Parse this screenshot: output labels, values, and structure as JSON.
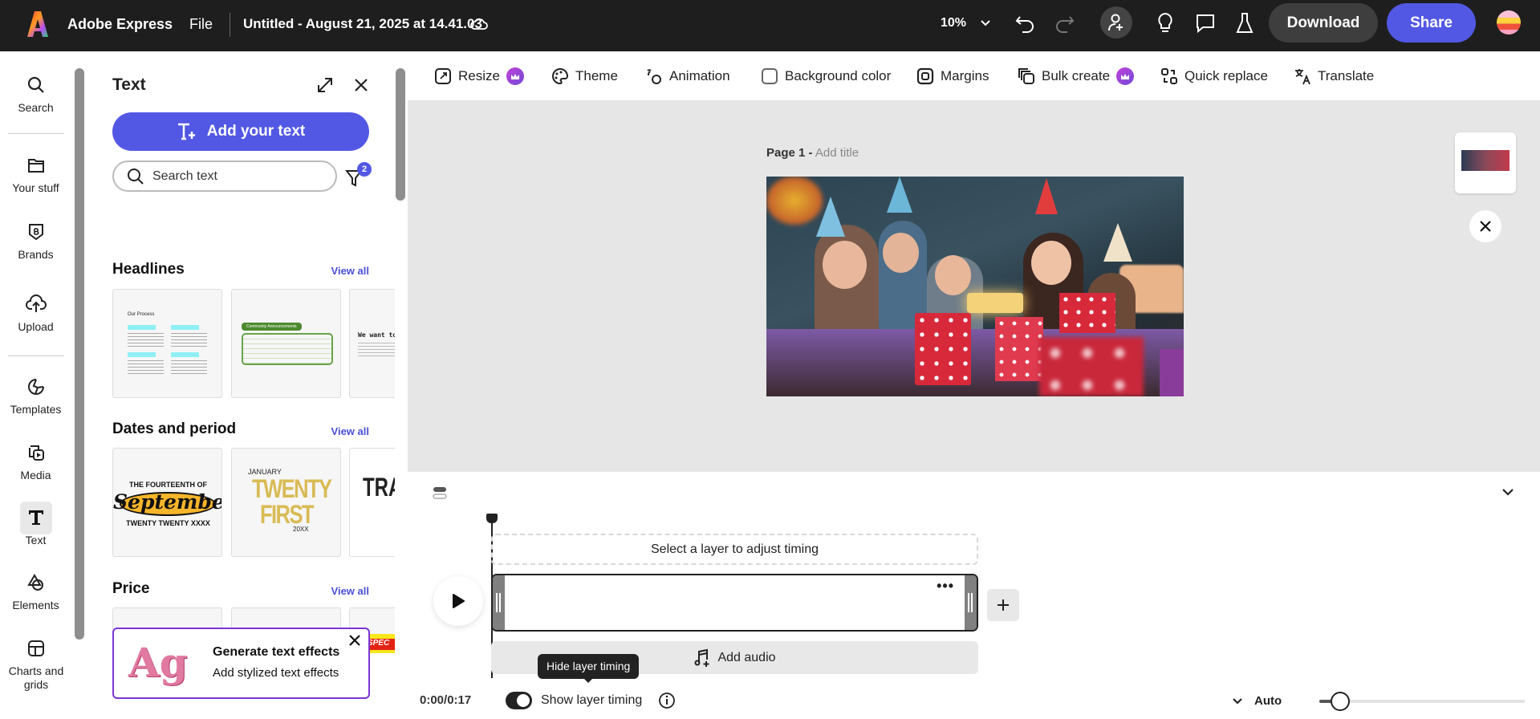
{
  "topbar": {
    "app_name": "Adobe Express",
    "file_menu": "File",
    "doc_title": "Untitled - August 21, 2025 at 14.41.03",
    "zoom": "10%",
    "download": "Download",
    "share": "Share"
  },
  "rail": {
    "items": [
      {
        "label": "Search",
        "icon": "search-icon"
      },
      {
        "label": "Your stuff",
        "icon": "folder-icon"
      },
      {
        "label": "Brands",
        "icon": "brand-icon"
      },
      {
        "label": "Upload",
        "icon": "upload-icon"
      },
      {
        "label": "Templates",
        "icon": "templates-icon"
      },
      {
        "label": "Media",
        "icon": "media-icon"
      },
      {
        "label": "Text",
        "icon": "text-icon",
        "active": true
      },
      {
        "label": "Elements",
        "icon": "elements-icon"
      },
      {
        "label": "Charts and grids",
        "icon": "charts-grids-icon"
      }
    ]
  },
  "panel": {
    "title": "Text",
    "add_text": "Add your text",
    "search_placeholder": "Search text",
    "filter_count": "2",
    "sections": [
      {
        "title": "Headlines",
        "view_all": "View all"
      },
      {
        "title": "Dates and period",
        "view_all": "View all"
      },
      {
        "title": "Price",
        "view_all": "View all"
      }
    ],
    "cards": {
      "process_title": "Our Process",
      "community": "Community Announcements",
      "contact": "We want to",
      "sept_top": "THE FOURTEENTH OF",
      "sept": "September",
      "sept_bottom": "TWENTY TWENTY XXXX",
      "jan": "JANUARY",
      "twenty": "TWENTY",
      "first": "FIRST",
      "year": "20XX",
      "tra": "TRA",
      "special": "SPEC"
    },
    "promo": {
      "title": "Generate text effects",
      "subtitle": "Add stylized text effects",
      "art": "Ag"
    }
  },
  "toolbar": {
    "items": [
      {
        "label": "Resize",
        "premium": true
      },
      {
        "label": "Theme"
      },
      {
        "label": "Animation"
      },
      {
        "label": "Background color"
      },
      {
        "label": "Margins"
      },
      {
        "label": "Bulk create",
        "premium": true
      },
      {
        "label": "Quick replace"
      },
      {
        "label": "Translate"
      }
    ]
  },
  "canvas": {
    "page_label": "Page 1 -",
    "add_title": "Add title"
  },
  "timeline": {
    "select_hint": "Select a layer to adjust timing",
    "add_audio": "Add audio",
    "tooltip": "Hide layer timing",
    "time": "0:00/0:17",
    "show_timing": "Show layer timing",
    "show_timing_on": true,
    "zoom_mode": "Auto",
    "zoom_slider": 0.1
  },
  "colors": {
    "accent": "#5258e4",
    "topbar": "#1e1e1e",
    "premium": "#a64bd8",
    "promo_border": "#7b36d6"
  }
}
